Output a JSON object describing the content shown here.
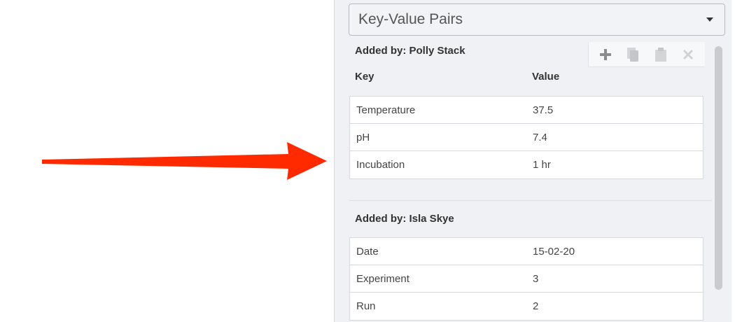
{
  "panel": {
    "dropdown_value": "Key-Value Pairs",
    "toolbar": {
      "add_icon": "plus-icon",
      "copy_icon": "copy-icon",
      "paste_icon": "clipboard-icon",
      "delete_icon": "close-icon"
    },
    "sections": [
      {
        "title": "Added by: Polly Stack",
        "columns": {
          "key": "Key",
          "value": "Value"
        },
        "rows": [
          {
            "key": "Temperature",
            "value": "37.5"
          },
          {
            "key": "pH",
            "value": "7.4"
          },
          {
            "key": "Incubation",
            "value": "1 hr"
          }
        ]
      },
      {
        "title": "Added by: Isla Skye",
        "rows": [
          {
            "key": "Date",
            "value": "15-02-20"
          },
          {
            "key": "Experiment",
            "value": "3"
          },
          {
            "key": "Run",
            "value": "2"
          }
        ]
      }
    ]
  },
  "annotation": {
    "arrow_color": "#ff2a00"
  }
}
